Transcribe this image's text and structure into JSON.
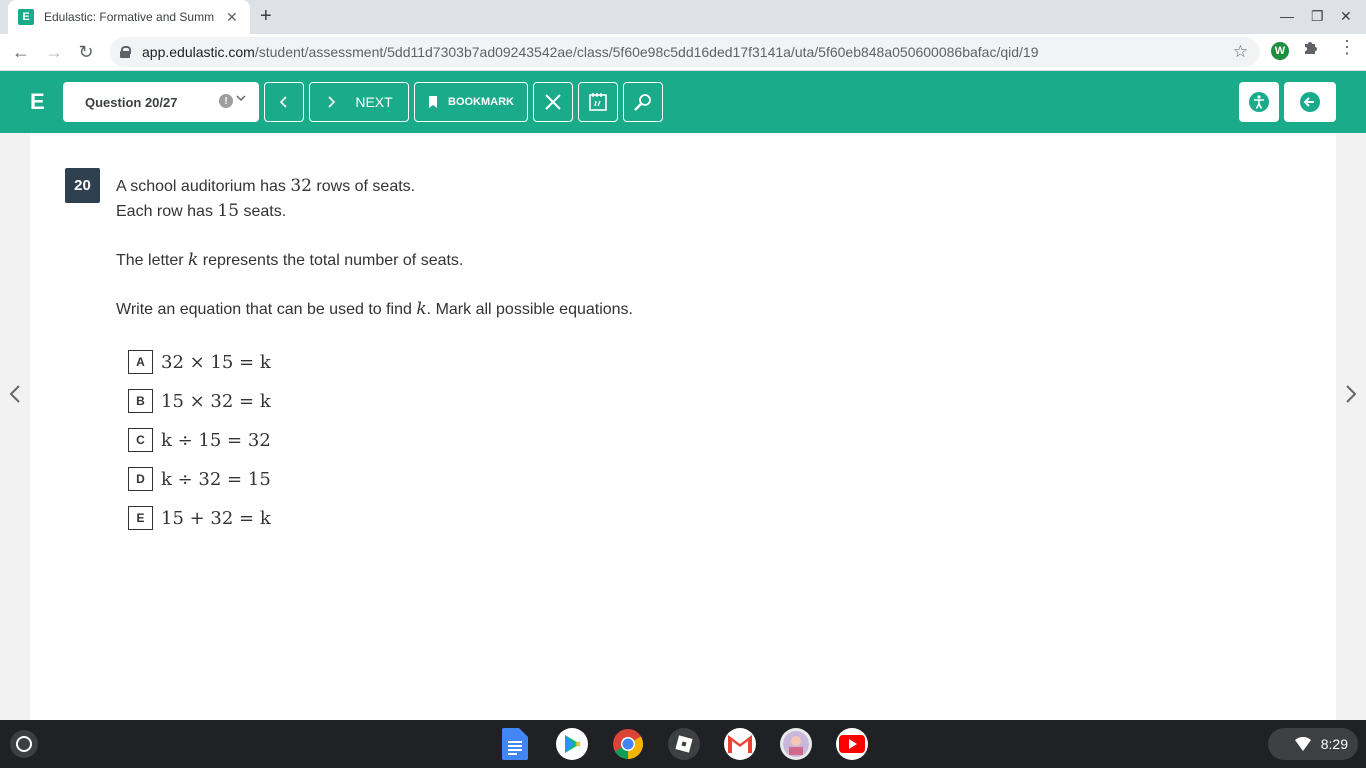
{
  "browser": {
    "tab_title": "Edulastic: Formative and Summ",
    "tab_favicon": "E",
    "url_domain": "app.edulastic.com",
    "url_path": "/student/assessment/5dd11d7303b7ad09243542ae/class/5f60e98c5dd16ded17f3141a/uta/5f60eb848a050600086bafac/qid/19",
    "extension_letter": "W"
  },
  "header": {
    "logo": "E",
    "question_select": "Question 20/27",
    "next_label": "NEXT",
    "bookmark_label": "BOOKMARK",
    "accent_color": "#1aab8b"
  },
  "question": {
    "number": "20",
    "line1_pre": "A school auditorium has ",
    "line1_num": "32",
    "line1_post": " rows of seats.",
    "line2_pre": "Each row has ",
    "line2_num": "15",
    "line2_post": " seats.",
    "line3_pre": "The letter ",
    "line3_var": "k",
    "line3_post": " represents the total number of seats.",
    "line4_pre": "Write an equation that can be used to find ",
    "line4_var": "k",
    "line4_post": ".  Mark all possible equations.",
    "options": [
      {
        "letter": "A",
        "expr": "32 × 15 = k"
      },
      {
        "letter": "B",
        "expr": "15 × 32 = k"
      },
      {
        "letter": "C",
        "expr": "k ÷ 15 = 32"
      },
      {
        "letter": "D",
        "expr": "k ÷ 32 = 15"
      },
      {
        "letter": "E",
        "expr": "15 + 32 = k"
      }
    ]
  },
  "shelf": {
    "time": "8:29",
    "apps": [
      "docs-icon",
      "play-store-icon",
      "chrome-icon",
      "roblox-icon",
      "gmail-icon",
      "app-avatar-icon",
      "youtube-icon"
    ]
  }
}
